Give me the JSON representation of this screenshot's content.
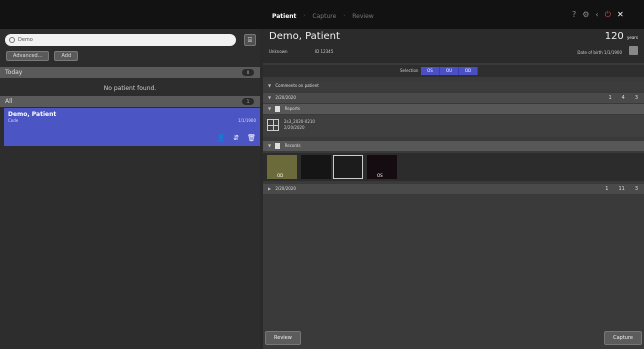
{
  "nav": {
    "tabs": [
      "Patient",
      "Capture",
      "Review"
    ],
    "separator": "›",
    "icons": [
      "help-icon",
      "settings-icon",
      "back-icon",
      "power-icon",
      "close-icon"
    ]
  },
  "search": {
    "value": "Demo"
  },
  "left": {
    "advanced_label": "Advanced...",
    "add_label": "Add",
    "today_label": "Today",
    "today_count": "0",
    "no_patient": "No patient found.",
    "all_label": "All",
    "all_count": "1",
    "patient": {
      "name": "Demo, Patient",
      "code": "Code",
      "date": "1/1/1900"
    }
  },
  "patient": {
    "name": "Demo, Patient",
    "age": "120",
    "age_unit": "years",
    "sex": "Unknown",
    "id": "ID 12345",
    "dob_label": "Date of birth",
    "dob": "1/1/1900"
  },
  "selection": {
    "label": "Selection",
    "options": [
      "OS",
      "OU",
      "OD"
    ]
  },
  "sections": {
    "comments": "Comments on patient",
    "date1": "2/20/2020",
    "reports": "Reports",
    "report_line1": "2s3_2020-0210",
    "report_line2": "2/20/2020",
    "records": "Records",
    "date2": "2/20/2020",
    "icon_counts": [
      "1",
      "4",
      "3"
    ],
    "icon_counts2": [
      "1",
      "11",
      "3"
    ]
  },
  "thumbnails": [
    {
      "name": "thumb-1",
      "label": "OD"
    },
    {
      "name": "thumb-2",
      "label": ""
    },
    {
      "name": "thumb-3",
      "label": ""
    },
    {
      "name": "thumb-4",
      "label": "OS"
    }
  ],
  "buttons": {
    "review": "Review",
    "capture": "Capture"
  }
}
